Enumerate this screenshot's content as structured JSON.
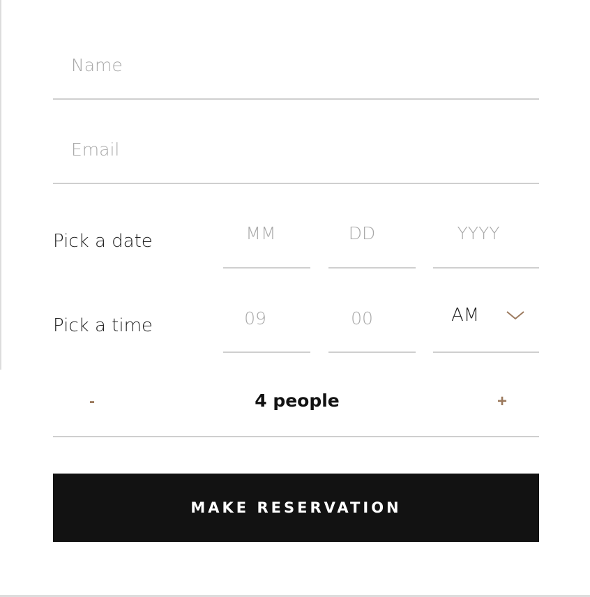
{
  "form": {
    "name": {
      "placeholder": "Name",
      "value": ""
    },
    "email": {
      "placeholder": "Email",
      "value": ""
    },
    "date": {
      "label": "Pick a date",
      "month_placeholder": "MM",
      "day_placeholder": "DD",
      "year_placeholder": "YYYY"
    },
    "time": {
      "label": "Pick a time",
      "hour_placeholder": "09",
      "minute_placeholder": "00",
      "period": "AM",
      "period_icon": "chevron-down-icon"
    },
    "party": {
      "decrement_label": "-",
      "value": "4 people",
      "increment_label": "+"
    },
    "submit_label": "MAKE RESERVATION"
  },
  "colors": {
    "accent": "#9c7a5e",
    "button_bg": "#121212",
    "line": "#cfcfcf",
    "placeholder": "#a8a8a8"
  }
}
